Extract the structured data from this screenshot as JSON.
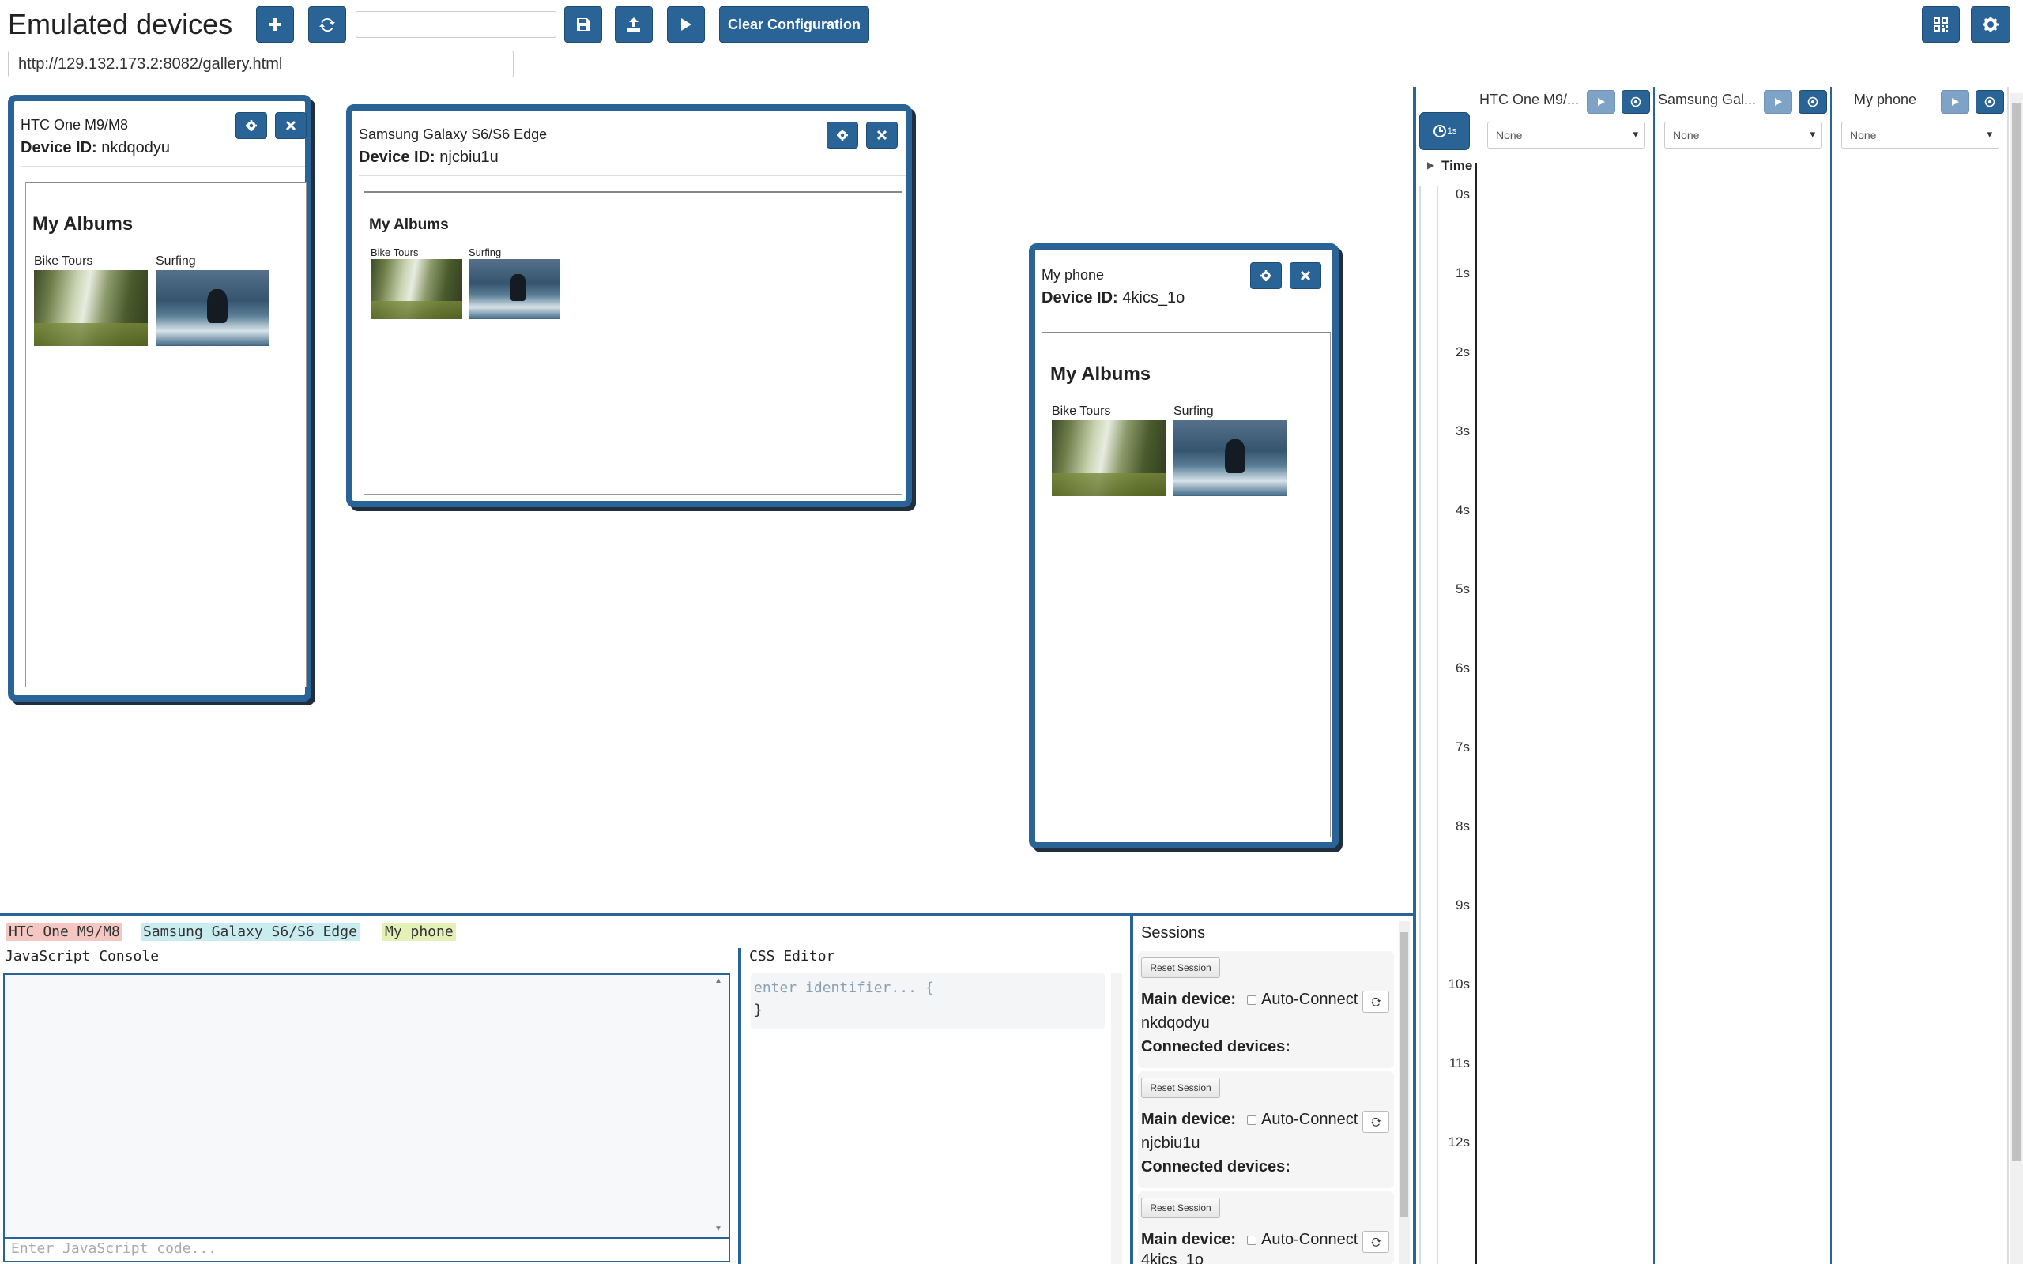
{
  "toolbar": {
    "title": "Emulated devices",
    "add_icon": "plus-icon",
    "refresh_icon": "refresh-icon",
    "config_name_value": "",
    "save_icon": "floppy-disk-icon",
    "upload_icon": "upload-icon",
    "play_icon": "play-icon",
    "clear_label": "Clear Configuration",
    "qr_icon": "qrcode-icon",
    "settings_icon": "gear-icon",
    "url": "http://129.132.173.2:8082/gallery.html"
  },
  "devices": [
    {
      "name": "HTC One M9/M8",
      "id_label": "Device ID:",
      "id": "nkdqodyu",
      "albums_title": "My Albums",
      "albums": [
        "Bike Tours",
        "Surfing"
      ]
    },
    {
      "name": "Samsung Galaxy S6/S6 Edge",
      "id_label": "Device ID:",
      "id": "njcbiu1u",
      "albums_title": "My Albums",
      "albums": [
        "Bike Tours",
        "Surfing"
      ]
    },
    {
      "name": "My phone",
      "id_label": "Device ID:",
      "id": "4kics_1o",
      "albums_title": "My Albums",
      "albums": [
        "Bike Tours",
        "Surfing"
      ]
    }
  ],
  "timeline": {
    "time_label": "Time",
    "columns": [
      {
        "name": "HTC One M9/...",
        "select": "None"
      },
      {
        "name": "Samsung Gal...",
        "select": "None"
      },
      {
        "name": "My phone",
        "select": "None"
      }
    ],
    "ticks": [
      "0s",
      "1s",
      "2s",
      "3s",
      "4s",
      "5s",
      "6s",
      "7s",
      "8s",
      "9s",
      "10s",
      "11s",
      "12s"
    ],
    "clock_button_label": "1s"
  },
  "bottom": {
    "device_tags": [
      {
        "label": "HTC One M9/M8",
        "color": "#f4c7c3"
      },
      {
        "label": "Samsung Galaxy S6/S6 Edge",
        "color": "#c9ecf0"
      },
      {
        "label": "My phone",
        "color": "#e5efb8"
      }
    ],
    "js_console_title": "JavaScript Console",
    "js_input_placeholder": "Enter JavaScript code...",
    "css_editor_title": "CSS Editor",
    "css_placeholder": "enter identifier... {",
    "css_close": "}",
    "sessions_title": "Sessions",
    "sessions": [
      {
        "reset": "Reset Session",
        "main_label": "Main device:",
        "auto": "Auto-Connect",
        "device_id": "nkdqodyu",
        "connected_label": "Connected devices:"
      },
      {
        "reset": "Reset Session",
        "main_label": "Main device:",
        "auto": "Auto-Connect",
        "device_id": "njcbiu1u",
        "connected_label": "Connected devices:"
      },
      {
        "reset": "Reset Session",
        "main_label": "Main device:",
        "auto": "Auto-Connect",
        "device_id": "4kics_1o",
        "connected_label": ""
      }
    ]
  },
  "colors": {
    "accent": "#2a6496"
  }
}
